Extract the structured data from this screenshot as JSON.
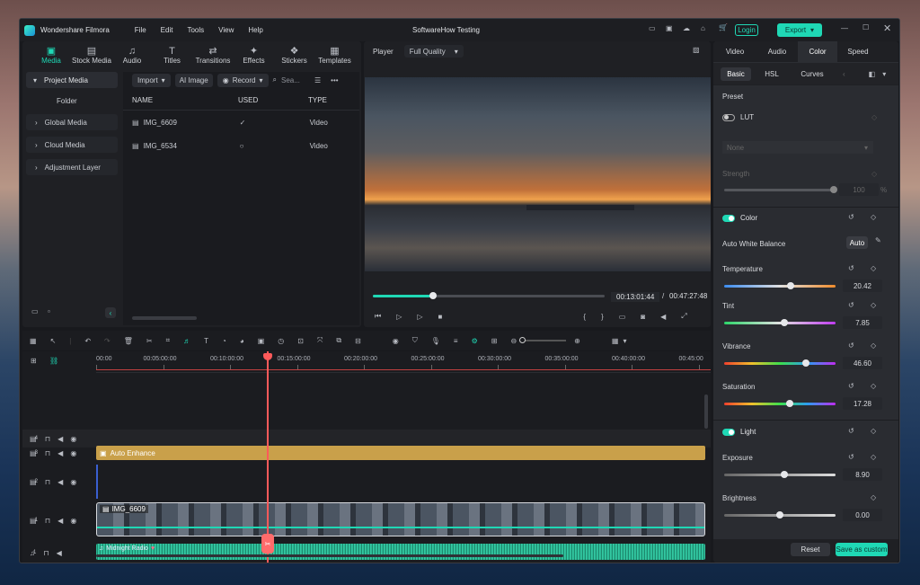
{
  "app": {
    "name": "Wondershare Filmora",
    "project": "SoftwareHow Testing",
    "menu": [
      "File",
      "Edit",
      "Tools",
      "View",
      "Help"
    ],
    "login": "Login",
    "export": "Export"
  },
  "toolbar": {
    "tabs": [
      "Media",
      "Stock Media",
      "Audio",
      "Titles",
      "Transitions",
      "Effects",
      "Stickers",
      "Templates"
    ]
  },
  "media": {
    "sidebar": [
      "Project Media",
      "Folder",
      "Global Media",
      "Cloud Media",
      "Adjustment Layer"
    ],
    "import": "Import",
    "ai_image": "AI Image",
    "record": "Record",
    "search": "Sea...",
    "columns": [
      "NAME",
      "USED",
      "TYPE"
    ],
    "rows": [
      {
        "name": "IMG_6609",
        "type": "Video"
      },
      {
        "name": "IMG_6534",
        "type": "Video"
      }
    ]
  },
  "player": {
    "label": "Player",
    "quality": "Full Quality",
    "current": "00:13:01:44",
    "sep": "/",
    "total": "00:47:27:48",
    "progress": 0.26
  },
  "right": {
    "tabs": [
      "Video",
      "Audio",
      "Color",
      "Speed"
    ],
    "subtabs": [
      "Basic",
      "HSL",
      "Curves"
    ],
    "preset": "Preset",
    "lut": "LUT",
    "none": "None",
    "strength": "Strength",
    "strength_val": "100",
    "pct": "%",
    "color": "Color",
    "awb": "Auto White Balance",
    "auto": "Auto",
    "temperature": "Temperature",
    "temp_val": "20.42",
    "tint": "Tint",
    "tint_val": "7.85",
    "vibrance": "Vibrance",
    "vib_val": "46.60",
    "saturation": "Saturation",
    "sat_val": "17.28",
    "light": "Light",
    "exposure": "Exposure",
    "exp_val": "8.90",
    "brightness": "Brightness",
    "bri_val": "0.00",
    "reset": "Reset",
    "save": "Save as custom",
    "levels": {
      "temperature": 0.6,
      "tint": 0.54,
      "vibrance": 0.73,
      "saturation": 0.59,
      "exposure": 0.54,
      "brightness": 0.5
    }
  },
  "timeline": {
    "ticks": [
      "00:00",
      "00:05:00:00",
      "00:10:00:00",
      "00:15:00:00",
      "00:20:00:00",
      "00:25:00:00",
      "00:30:00:00",
      "00:35:00:00",
      "00:40:00:00",
      "00:45:00"
    ],
    "tracks": [
      "4",
      "3",
      "2",
      "1",
      "1"
    ],
    "clips": {
      "effect": "Auto Enhance",
      "video": "IMG_6609",
      "audio": "Midnight Radio"
    }
  },
  "colors": {
    "accent": "#1fd8b5",
    "playhead": "#ff5a5a",
    "effect": "#c9a04a"
  }
}
